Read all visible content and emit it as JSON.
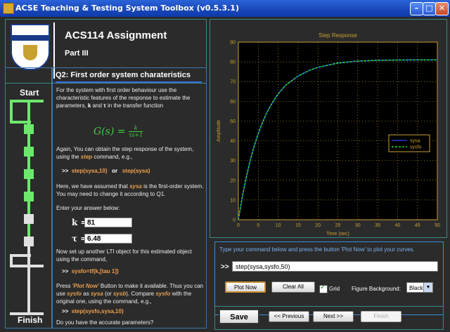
{
  "window": {
    "title": "ACSE Teaching & Testing System Toolbox (v0.5.3.1)"
  },
  "header": {
    "title": "ACS114 Assignment",
    "subtitle": "Part III"
  },
  "nav": {
    "start": "Start",
    "finish": "Finish"
  },
  "question": {
    "title": "Q2: First order system charateristics",
    "p1_a": "For the system with first order behaviour use the characteristic features of the response to estimate the parameters, ",
    "p1_k": "k",
    "p1_b": " and ",
    "p1_tau": "τ",
    "p1_c": " in the transfer function",
    "formula_lhs": "G(s) =",
    "formula_num": "k",
    "formula_den": "τs+1",
    "p2_a": "Again, You can obtain the step response of the system, using the ",
    "p2_cmd": "step",
    "p2_b": " command, e.g.,",
    "cmd1_prompt": ">>",
    "cmd1_a": "step(sysa,10)",
    "cmd1_or": "or",
    "cmd1_b": "step(sysa)",
    "p3_a": "Here, we have assumed that ",
    "p3_var": "sysa",
    "p3_b": " is the first-order system. You may need to change it according to Q1.",
    "p4": "Enter your answer below:",
    "k_label": "k =",
    "k_value": "81",
    "tau_label": "τ =",
    "tau_value": "6.48",
    "p5": "Now set up another LTI object for this estimated object using the command,",
    "cmd2_prompt": ">>",
    "cmd2": "sysfo=tf(k,[tau 1])",
    "p6_a": "Press ",
    "p6_btn": "'Plot Now'",
    "p6_b": " Button to make it available. Thus you can use ",
    "p6_v1": "sysfo",
    "p6_c": " as ",
    "p6_v2": "sysa",
    "p6_d": " (or ",
    "p6_v3": "sysb",
    "p6_e": "). Compare ",
    "p6_v4": "sysfo",
    "p6_f": " with the original one, using the command, e.g.,",
    "cmd3_prompt": ">>",
    "cmd3": "step(sysfo,sysa,10)",
    "p7": "Do you have the accurate parameters?"
  },
  "chart_data": {
    "type": "line",
    "title": "Step Response",
    "xlabel": "Time (sec)",
    "ylabel": "Amplitude",
    "xlim": [
      0,
      50
    ],
    "ylim": [
      0,
      90
    ],
    "xticks": [
      "0",
      "5",
      "10",
      "15",
      "20",
      "25",
      "30",
      "35",
      "40",
      "45",
      "50"
    ],
    "yticks": [
      "0",
      "10",
      "20",
      "30",
      "40",
      "50",
      "60",
      "70",
      "80",
      "90"
    ],
    "legend_position": "right",
    "grid": true,
    "series": [
      {
        "name": "sysa",
        "style": "solid",
        "color": "#2a3ad8",
        "x": [
          0,
          1,
          2,
          3,
          4,
          5,
          6,
          7,
          8,
          10,
          12,
          15,
          18,
          20,
          25,
          30,
          35,
          40,
          45,
          50
        ],
        "y": [
          0,
          11.7,
          21.6,
          30.2,
          37.4,
          43.7,
          49.0,
          53.6,
          57.5,
          63.8,
          68.4,
          72.8,
          75.8,
          77.2,
          79.4,
          80.4,
          80.8,
          80.9,
          81,
          81
        ]
      },
      {
        "name": "sysfo",
        "style": "dashed",
        "color": "#22d822",
        "x": [
          0,
          1,
          2,
          3,
          4,
          5,
          6,
          7,
          8,
          10,
          12,
          15,
          18,
          20,
          25,
          30,
          35,
          40,
          45,
          50
        ],
        "y": [
          0,
          11.7,
          21.6,
          30.2,
          37.4,
          43.7,
          49.0,
          53.6,
          57.5,
          63.8,
          68.4,
          72.8,
          75.8,
          77.2,
          79.4,
          80.4,
          80.8,
          80.9,
          81,
          81
        ]
      }
    ]
  },
  "command": {
    "hint": "Type your command below and press the button 'Plot Now' to plot your curves.",
    "prompt": ">>",
    "value": "step(sysa,sysfo,50)",
    "plot_now": "Plot Now",
    "clear_all": "Clear All",
    "grid_label": "Grid",
    "bg_label": "Figure Background:",
    "bg_value": "Black"
  },
  "footer": {
    "save": "Save",
    "previous": "<< Previous",
    "next": "Next >>",
    "finish": "Finish"
  }
}
